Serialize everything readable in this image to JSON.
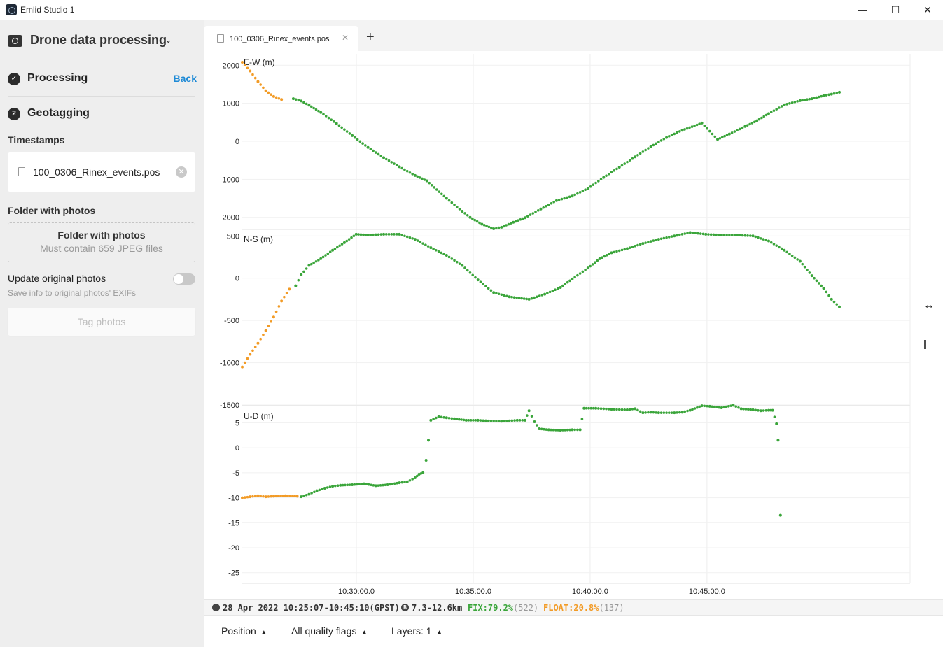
{
  "window": {
    "title": "Emlid Studio 1",
    "minimize": "—",
    "maximize": "☐",
    "close": "✕"
  },
  "sidebar": {
    "project_title": "Drone data processing",
    "step1": {
      "label": "Processing",
      "back": "Back"
    },
    "step2": {
      "number": "2",
      "label": "Geotagging"
    },
    "timestamps_label": "Timestamps",
    "timestamps_file": "100_0306_Rinex_events.pos",
    "folder_label": "Folder with photos",
    "folder_drop_title": "Folder with photos",
    "folder_drop_sub": "Must contain 659 JPEG files",
    "update_label": "Update original photos",
    "update_sub": "Save info to original photos' EXIFs",
    "update_enabled": false,
    "tag_button": "Tag photos"
  },
  "tabs": [
    {
      "label": "100_0306_Rinex_events.pos"
    }
  ],
  "status": {
    "date_range": "28 Apr 2022 10:25:07-10:45:10(GPST)",
    "base_range": "7.3-12.6km",
    "fix": "FIX:79.2%",
    "fix_count": "(522)",
    "float": "FLOAT:20.8%",
    "float_count": "(137)"
  },
  "bottom": {
    "position": "Position",
    "quality": "All quality flags",
    "layers": "Layers: 1"
  },
  "colors": {
    "fix": "#3aa53a",
    "float": "#f29b26"
  },
  "chart_data": {
    "type": "scatter",
    "x_ticks": [
      "10:30:00.0",
      "10:35:00.0",
      "10:40:00.0",
      "10:45:00.0"
    ],
    "x_unit": "minutes since 10:25:07",
    "panels": [
      {
        "ylabel": "E-W (m)",
        "ylim": [
          -2300,
          2300
        ],
        "yticks": [
          2000,
          1000,
          0,
          -1000,
          -2000
        ],
        "float": [
          [
            0.0,
            2080
          ],
          [
            1.0,
            1850
          ],
          [
            2.0,
            1570
          ],
          [
            3.0,
            1330
          ],
          [
            4.0,
            1180
          ],
          [
            5.0,
            1100
          ]
        ],
        "fix": [
          [
            6.5,
            1120
          ],
          [
            7.5,
            1060
          ],
          [
            8.5,
            950
          ],
          [
            10,
            760
          ],
          [
            12,
            470
          ],
          [
            14,
            150
          ],
          [
            16,
            -160
          ],
          [
            18,
            -430
          ],
          [
            20,
            -670
          ],
          [
            22,
            -900
          ],
          [
            23.5,
            -1040
          ],
          [
            26,
            -1500
          ],
          [
            28,
            -1840
          ],
          [
            29,
            -2000
          ],
          [
            30.5,
            -2180
          ],
          [
            32,
            -2300
          ],
          [
            33,
            -2260
          ],
          [
            34.5,
            -2130
          ],
          [
            36,
            -2010
          ],
          [
            38,
            -1780
          ],
          [
            40,
            -1560
          ],
          [
            42,
            -1440
          ],
          [
            44,
            -1240
          ],
          [
            46,
            -950
          ],
          [
            48,
            -680
          ],
          [
            50,
            -410
          ],
          [
            52,
            -140
          ],
          [
            54,
            100
          ],
          [
            56,
            290
          ],
          [
            58.5,
            480
          ],
          [
            60.5,
            50
          ],
          [
            62,
            190
          ],
          [
            64,
            390
          ],
          [
            65.5,
            540
          ],
          [
            67,
            730
          ],
          [
            69,
            960
          ],
          [
            71,
            1070
          ],
          [
            72.5,
            1120
          ],
          [
            74,
            1200
          ],
          [
            75,
            1240
          ],
          [
            76,
            1290
          ]
        ]
      },
      {
        "ylabel": "N-S (m)",
        "ylim": [
          -1500,
          560
        ],
        "yticks": [
          500,
          0,
          -500,
          -1000,
          -1500
        ],
        "float": [
          [
            0.0,
            -1050
          ],
          [
            1.0,
            -900
          ],
          [
            2.0,
            -770
          ],
          [
            3.0,
            -620
          ],
          [
            4.0,
            -460
          ],
          [
            5.0,
            -270
          ],
          [
            6.0,
            -130
          ]
        ],
        "fix": [
          [
            6.8,
            -90
          ],
          [
            7.5,
            40
          ],
          [
            8.5,
            150
          ],
          [
            10,
            230
          ],
          [
            11.5,
            330
          ],
          [
            13,
            420
          ],
          [
            14.5,
            520
          ],
          [
            16,
            510
          ],
          [
            18,
            520
          ],
          [
            20,
            520
          ],
          [
            22,
            460
          ],
          [
            24,
            360
          ],
          [
            26,
            270
          ],
          [
            28,
            150
          ],
          [
            30,
            -20
          ],
          [
            32,
            -170
          ],
          [
            34,
            -220
          ],
          [
            36.5,
            -250
          ],
          [
            38.5,
            -190
          ],
          [
            40.5,
            -110
          ],
          [
            42,
            -10
          ],
          [
            44,
            120
          ],
          [
            45.5,
            230
          ],
          [
            47,
            300
          ],
          [
            49,
            350
          ],
          [
            51,
            410
          ],
          [
            53,
            460
          ],
          [
            55,
            500
          ],
          [
            57,
            540
          ],
          [
            59,
            520
          ],
          [
            61,
            510
          ],
          [
            63,
            510
          ],
          [
            65,
            500
          ],
          [
            67,
            440
          ],
          [
            69,
            330
          ],
          [
            71,
            200
          ],
          [
            72.5,
            30
          ],
          [
            74,
            -120
          ],
          [
            75,
            -250
          ],
          [
            76,
            -340
          ]
        ]
      },
      {
        "ylabel": "U-D (m)",
        "ylim": [
          -27,
          8
        ],
        "yticks": [
          5,
          0,
          -5,
          -10,
          -15,
          -20,
          -25
        ],
        "float": [
          [
            0.0,
            -10.0
          ],
          [
            1.0,
            -9.8
          ],
          [
            2.0,
            -9.6
          ],
          [
            3.0,
            -9.8
          ],
          [
            4.0,
            -9.7
          ],
          [
            5.5,
            -9.6
          ],
          [
            7.0,
            -9.7
          ]
        ],
        "fix": [
          [
            7.5,
            -9.8
          ],
          [
            8.5,
            -9.3
          ],
          [
            9.5,
            -8.6
          ],
          [
            10.5,
            -8.1
          ],
          [
            11.5,
            -7.7
          ],
          [
            12.5,
            -7.5
          ],
          [
            14,
            -7.4
          ],
          [
            15.5,
            -7.2
          ],
          [
            17,
            -7.6
          ],
          [
            18.5,
            -7.4
          ],
          [
            20,
            -7.0
          ],
          [
            21,
            -6.8
          ],
          [
            22,
            -6.0
          ],
          [
            22.5,
            -5.3
          ],
          [
            23,
            -5.0
          ],
          [
            23.4,
            -2.5
          ],
          [
            23.7,
            1.5
          ],
          [
            24,
            5.5
          ],
          [
            25,
            6.2
          ],
          [
            26,
            6.0
          ],
          [
            27,
            5.8
          ],
          [
            28.5,
            5.5
          ],
          [
            30,
            5.5
          ],
          [
            31,
            5.4
          ],
          [
            33,
            5.3
          ],
          [
            35,
            5.5
          ],
          [
            36,
            5.5
          ],
          [
            36.5,
            7.4
          ],
          [
            37.2,
            5.2
          ],
          [
            37.8,
            3.8
          ],
          [
            39,
            3.6
          ],
          [
            40.5,
            3.5
          ],
          [
            42,
            3.6
          ],
          [
            43,
            3.6
          ],
          [
            43.5,
            7.9
          ],
          [
            45,
            7.9
          ],
          [
            47,
            7.7
          ],
          [
            49,
            7.6
          ],
          [
            50,
            7.8
          ],
          [
            51,
            7.0
          ],
          [
            52,
            7.1
          ],
          [
            53,
            7.0
          ],
          [
            55,
            7.0
          ],
          [
            56,
            7.1
          ],
          [
            57,
            7.5
          ],
          [
            58.5,
            8.4
          ],
          [
            59.5,
            8.3
          ],
          [
            61,
            8.0
          ],
          [
            62.5,
            8.5
          ],
          [
            63.5,
            7.8
          ],
          [
            65,
            7.6
          ],
          [
            66,
            7.4
          ],
          [
            67,
            7.5
          ],
          [
            67.5,
            7.5
          ],
          [
            68,
            4.8
          ],
          [
            68.2,
            1.5
          ],
          [
            68.5,
            -13.5
          ]
        ]
      }
    ]
  }
}
